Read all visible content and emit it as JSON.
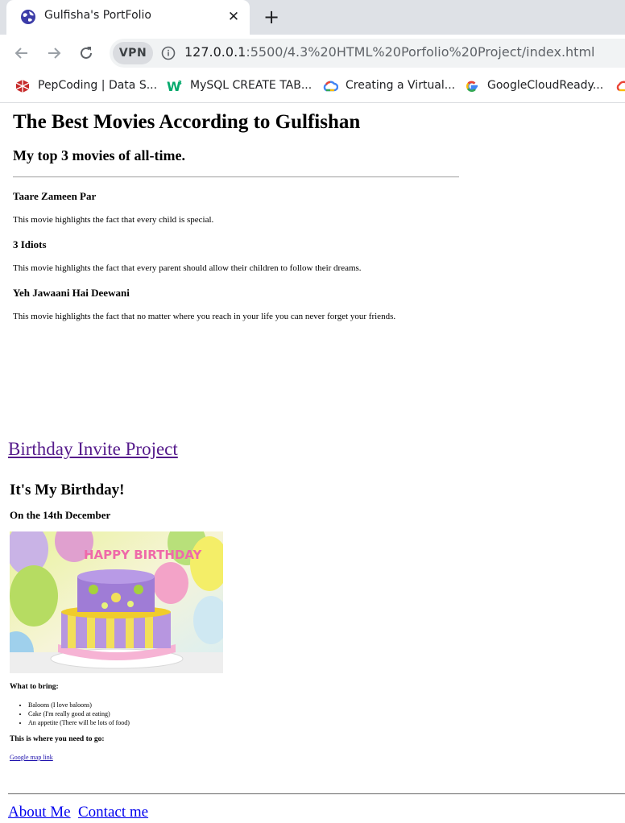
{
  "browser": {
    "tab_title": "Gulfisha's PortFolio",
    "tab_close": "✕",
    "new_tab": "+",
    "vpn_label": "VPN",
    "url_host": "127.0.0.1",
    "url_rest": ":5500/4.3%20HTML%20Porfolio%20Project/index.html",
    "bookmarks": [
      {
        "label": "PepCoding | Data S...",
        "icon": "pepcoding-icon"
      },
      {
        "label": "MySQL CREATE TAB...",
        "icon": "w3schools-icon"
      },
      {
        "label": "Creating a Virtual...",
        "icon": "google-cloud-icon"
      },
      {
        "label": "GoogleCloudReady...",
        "icon": "google-icon"
      }
    ]
  },
  "page": {
    "heading": "The Best Movies According to Gulfishan",
    "subheading": "My top 3 movies of all-time.",
    "movies": [
      {
        "title": "Taare Zameen Par",
        "desc": "This movie highlights the fact that every child is special."
      },
      {
        "title": "3 Idiots",
        "desc": "This movie highlights the fact that every parent should allow their children to follow their dreams."
      },
      {
        "title": "Yeh Jawaani Hai Deewani",
        "desc": "This movie highlights the fact that no matter where you reach in your life you can never forget your friends."
      }
    ],
    "birthday_link": "Birthday Invite Project",
    "birthday_heading": "It's My Birthday!",
    "birthday_date": "On the 14th December",
    "cake_text": "HAPPY BIRTHDAY",
    "bring_heading": "What to bring:",
    "bring_items": [
      "Baloons (I love baloons)",
      "Cake (I'm really good at eating)",
      "An appetite (There will be lots of food)"
    ],
    "go_heading": "This is where you need to go:",
    "map_link": "Google map link",
    "footer_links": [
      "About Me",
      "Contact me"
    ]
  },
  "colors": {
    "visited_link": "#551a8b",
    "link": "#0000ee",
    "tabstrip": "#dee1e6"
  }
}
